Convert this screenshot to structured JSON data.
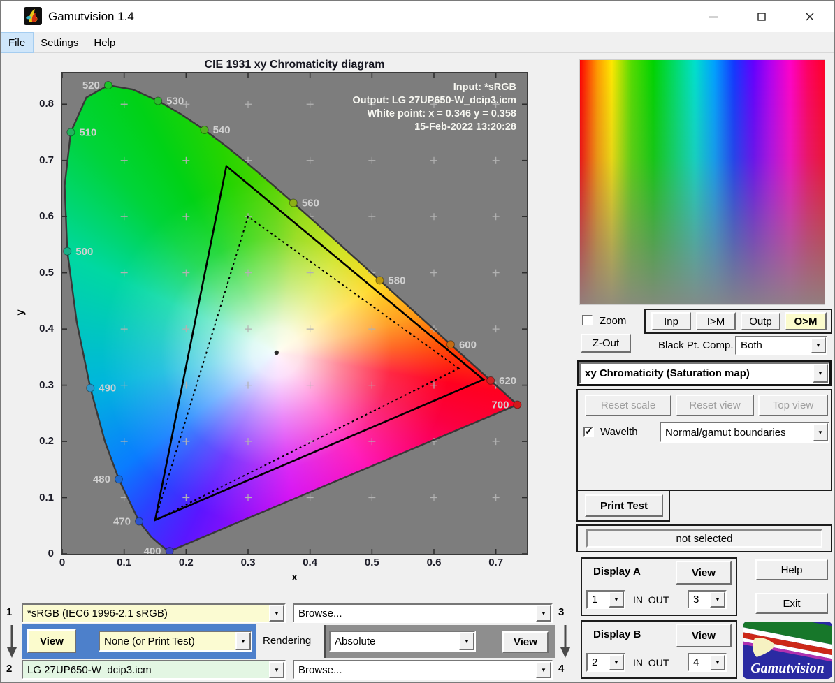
{
  "window": {
    "title": "Gamutvision 1.4"
  },
  "menu": {
    "items": [
      "File",
      "Settings",
      "Help"
    ]
  },
  "chart_data": {
    "type": "scatter",
    "title": "CIE 1931 xy Chromaticity diagram",
    "xlabel": "x",
    "ylabel": "y",
    "xlim": [
      0,
      0.75
    ],
    "ylim": [
      0,
      0.855
    ],
    "x_ticks": [
      0,
      0.1,
      0.2,
      0.3,
      0.4,
      0.5,
      0.6,
      0.7
    ],
    "y_ticks": [
      0,
      0.1,
      0.2,
      0.3,
      0.4,
      0.5,
      0.6,
      0.7,
      0.8
    ],
    "grid_step": 0.1,
    "grid": true,
    "annotation": [
      "Input:  *sRGB",
      "Output: LG 27UP650-W_dcip3.icm",
      "White point:  x = 0.346  y = 0.358",
      "15-Feb-2022 13:20:28"
    ],
    "white_point": {
      "x": 0.346,
      "y": 0.358
    },
    "gamuts": [
      {
        "name": "output-gamut-LG-27UP650-W-dcip3",
        "style": "solid",
        "points": [
          [
            0.68,
            0.31
          ],
          [
            0.265,
            0.69
          ],
          [
            0.15,
            0.06
          ]
        ]
      },
      {
        "name": "input-gamut-sRGB",
        "style": "dotted",
        "points": [
          [
            0.64,
            0.33
          ],
          [
            0.3,
            0.6
          ],
          [
            0.15,
            0.06
          ]
        ]
      }
    ],
    "wavelength_markers": [
      {
        "nm": "400",
        "x": 0.1733,
        "y": 0.0048,
        "color": "#3a3ec6",
        "side": "left"
      },
      {
        "nm": "470",
        "x": 0.1241,
        "y": 0.0578,
        "color": "#2a52d2",
        "side": "left"
      },
      {
        "nm": "480",
        "x": 0.0913,
        "y": 0.1327,
        "color": "#1e6ad0",
        "side": "left"
      },
      {
        "nm": "490",
        "x": 0.0454,
        "y": 0.295,
        "color": "#2e96c8",
        "side": "right"
      },
      {
        "nm": "500",
        "x": 0.0082,
        "y": 0.5384,
        "color": "#18b088",
        "side": "right"
      },
      {
        "nm": "510",
        "x": 0.0139,
        "y": 0.7502,
        "color": "#22b45c",
        "side": "right"
      },
      {
        "nm": "520",
        "x": 0.0743,
        "y": 0.8338,
        "color": "#18c626",
        "side": "left"
      },
      {
        "nm": "530",
        "x": 0.1547,
        "y": 0.8059,
        "color": "#2cba2c",
        "side": "right"
      },
      {
        "nm": "540",
        "x": 0.2296,
        "y": 0.7543,
        "color": "#50b020",
        "side": "right"
      },
      {
        "nm": "560",
        "x": 0.3731,
        "y": 0.6245,
        "color": "#8cb016",
        "side": "right"
      },
      {
        "nm": "580",
        "x": 0.5125,
        "y": 0.4866,
        "color": "#ba9610",
        "side": "right"
      },
      {
        "nm": "600",
        "x": 0.627,
        "y": 0.3725,
        "color": "#c46c14",
        "side": "right"
      },
      {
        "nm": "620",
        "x": 0.6915,
        "y": 0.3083,
        "color": "#cc2424",
        "side": "right"
      },
      {
        "nm": "700",
        "x": 0.7347,
        "y": 0.2653,
        "color": "#d01a1a",
        "side": "left"
      }
    ],
    "locus": [
      [
        0.1741,
        0.005
      ],
      [
        0.1733,
        0.0048
      ],
      [
        0.1726,
        0.0048
      ],
      [
        0.1714,
        0.0051
      ],
      [
        0.1689,
        0.0069
      ],
      [
        0.1644,
        0.0109
      ],
      [
        0.1566,
        0.0177
      ],
      [
        0.144,
        0.0297
      ],
      [
        0.1241,
        0.0578
      ],
      [
        0.0913,
        0.1327
      ],
      [
        0.0687,
        0.2007
      ],
      [
        0.0454,
        0.295
      ],
      [
        0.0235,
        0.4127
      ],
      [
        0.0082,
        0.5384
      ],
      [
        0.0039,
        0.6548
      ],
      [
        0.0139,
        0.7502
      ],
      [
        0.0389,
        0.812
      ],
      [
        0.0743,
        0.8338
      ],
      [
        0.1142,
        0.8262
      ],
      [
        0.1547,
        0.8059
      ],
      [
        0.1929,
        0.7816
      ],
      [
        0.2296,
        0.7543
      ],
      [
        0.2658,
        0.7243
      ],
      [
        0.3016,
        0.6923
      ],
      [
        0.3373,
        0.6589
      ],
      [
        0.3731,
        0.6245
      ],
      [
        0.4087,
        0.5896
      ],
      [
        0.4441,
        0.5547
      ],
      [
        0.4788,
        0.5202
      ],
      [
        0.5125,
        0.4866
      ],
      [
        0.5448,
        0.4544
      ],
      [
        0.5752,
        0.4242
      ],
      [
        0.6029,
        0.3965
      ],
      [
        0.627,
        0.3725
      ],
      [
        0.6482,
        0.3514
      ],
      [
        0.6658,
        0.334
      ],
      [
        0.6801,
        0.3197
      ],
      [
        0.6915,
        0.3083
      ],
      [
        0.7006,
        0.2993
      ],
      [
        0.7079,
        0.292
      ],
      [
        0.714,
        0.2859
      ],
      [
        0.719,
        0.2809
      ],
      [
        0.723,
        0.277
      ],
      [
        0.726,
        0.274
      ],
      [
        0.7283,
        0.2717
      ],
      [
        0.73,
        0.27
      ],
      [
        0.7329,
        0.2671
      ],
      [
        0.7347,
        0.2653
      ]
    ]
  },
  "right_panel": {
    "zoom_label": "Zoom",
    "buttons": {
      "inp": "Inp",
      "im": "I>M",
      "outp": "Outp",
      "om": "O>M"
    },
    "zout": "Z-Out",
    "bpc_label": "Black Pt. Comp.",
    "bpc_value": "Both",
    "view_mode": "xy Chromaticity (Saturation map)",
    "reset_scale": "Reset scale",
    "reset_view": "Reset view",
    "top_view": "Top view",
    "wavelth": "Wavelth",
    "boundaries": "Normal/gamut boundaries",
    "print_test": "Print Test",
    "not_selected": "not selected",
    "display_a": {
      "title": "Display A",
      "view": "View",
      "in": "1",
      "inout": "IN  OUT",
      "out": "3"
    },
    "display_b": {
      "title": "Display B",
      "view": "View",
      "in": "2",
      "inout": "IN  OUT",
      "out": "4"
    },
    "help": "Help",
    "exit": "Exit",
    "logo_text": "Gamutvision"
  },
  "bottom_panel": {
    "num1": "1",
    "num2": "2",
    "num3": "3",
    "num4": "4",
    "input_profile": "*sRGB   (IEC6 1996-2.1 sRGB)",
    "output_profile": "LG 27UP650-W_dcip3.icm",
    "browse_top": "Browse...",
    "browse_bottom": "Browse...",
    "view_left": "View",
    "view_right": "View",
    "none_print": "None (or Print Test)",
    "rendering_label": "Rendering",
    "rendering_intent": "Absolute"
  },
  "colors": {
    "accent_yellow": "#fbfbcd",
    "blue_panel": "#4d80cb",
    "plot_background": "#7d7d7d",
    "input_combo": "#fbfbd2",
    "output_combo": "#e3f6e3"
  }
}
